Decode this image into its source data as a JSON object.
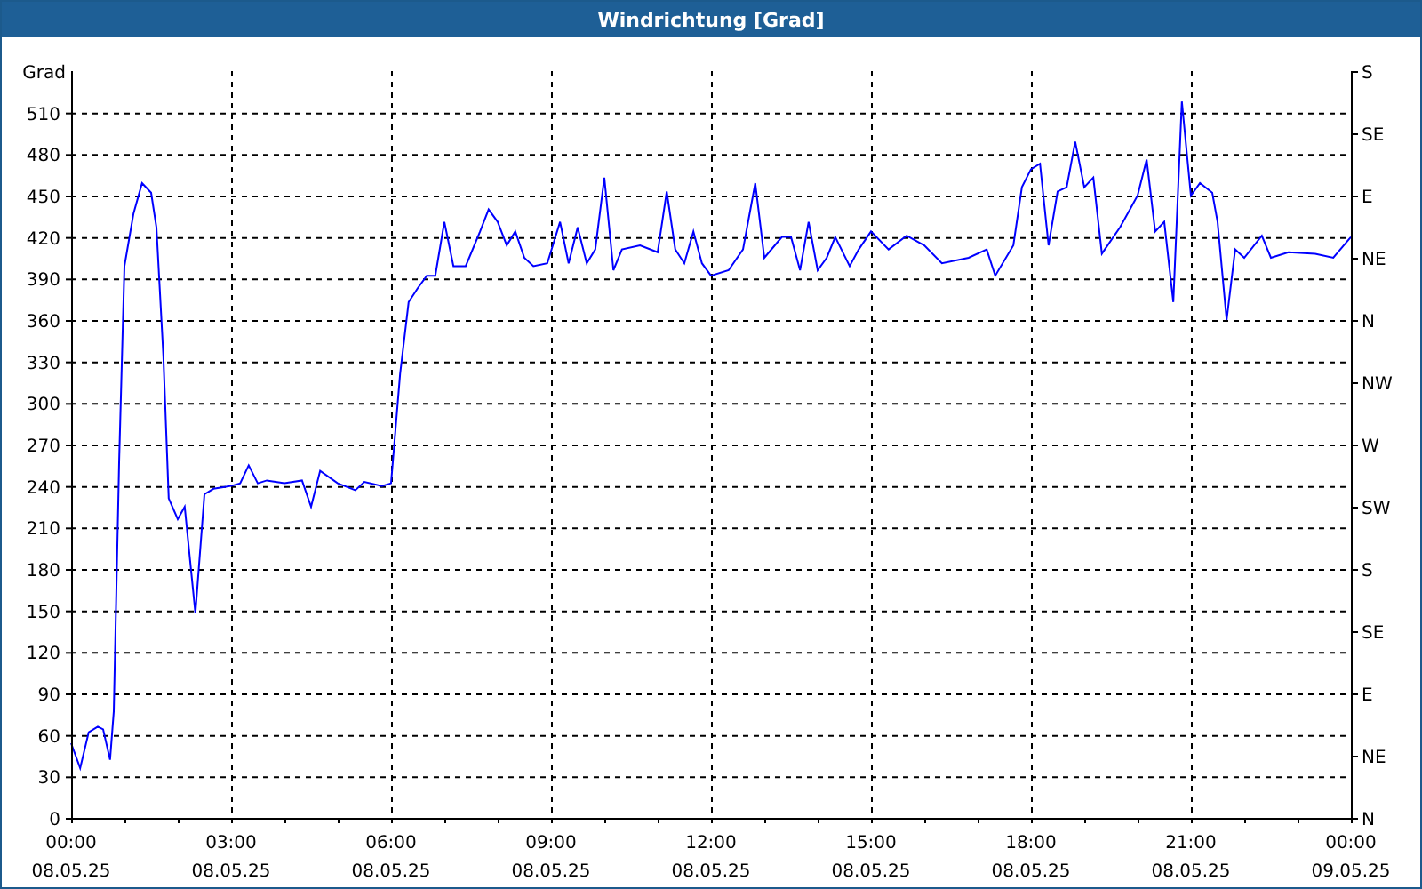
{
  "window": {
    "title": "Windrichtung [Grad]"
  },
  "chart": {
    "xtick_dates": [
      "08.05.25",
      "08.05.25",
      "08.05.25",
      "08.05.25",
      "08.05.25",
      "08.05.25",
      "08.05.25",
      "08.05.25",
      "09.05.25"
    ],
    "right_axis": [
      "S",
      "SE",
      "E",
      "NE",
      "N",
      "NW",
      "W",
      "SW",
      "S",
      "SE",
      "E",
      "NE",
      "N"
    ],
    "chart_data": {
      "type": "line",
      "grid": true,
      "ylabel": "Grad",
      "xlim": [
        0,
        24
      ],
      "ylim": [
        0,
        540
      ],
      "xticks": [
        {
          "value": 0,
          "label": "00:00"
        },
        {
          "value": 3,
          "label": "03:00"
        },
        {
          "value": 6,
          "label": "06:00"
        },
        {
          "value": 9,
          "label": "09:00"
        },
        {
          "value": 12,
          "label": "12:00"
        },
        {
          "value": 15,
          "label": "15:00"
        },
        {
          "value": 18,
          "label": "18:00"
        },
        {
          "value": 21,
          "label": "21:00"
        },
        {
          "value": 24,
          "label": "00:00"
        }
      ],
      "yticks": [
        0,
        30,
        60,
        90,
        120,
        150,
        180,
        210,
        240,
        270,
        300,
        330,
        360,
        390,
        420,
        450,
        480,
        510
      ],
      "x": [
        0,
        0.17,
        0.33,
        0.5,
        0.6,
        0.73,
        0.8,
        0.9,
        1,
        1.17,
        1.33,
        1.5,
        1.6,
        1.73,
        1.83,
        2,
        2.13,
        2.33,
        2.5,
        2.67,
        3,
        3.17,
        3.33,
        3.5,
        3.67,
        4,
        4.33,
        4.5,
        4.67,
        5,
        5.33,
        5.5,
        5.83,
        6,
        6.17,
        6.33,
        6.5,
        6.67,
        6.83,
        7,
        7.17,
        7.4,
        7.67,
        7.83,
        8,
        8.17,
        8.33,
        8.5,
        8.67,
        8.93,
        9.17,
        9.33,
        9.5,
        9.67,
        9.83,
        10,
        10.17,
        10.33,
        10.67,
        11,
        11.17,
        11.33,
        11.5,
        11.67,
        11.83,
        12,
        12.33,
        12.6,
        12.83,
        13,
        13.33,
        13.5,
        13.67,
        13.83,
        14,
        14.17,
        14.33,
        14.6,
        14.77,
        15,
        15.33,
        15.67,
        16,
        16.33,
        16.83,
        17.17,
        17.33,
        17.67,
        17.83,
        18,
        18.17,
        18.33,
        18.5,
        18.67,
        18.83,
        19,
        19.17,
        19.33,
        19.67,
        20,
        20.17,
        20.33,
        20.5,
        20.67,
        20.83,
        21,
        21.17,
        21.4,
        21.5,
        21.67,
        21.83,
        22,
        22.33,
        22.5,
        22.83,
        23.33,
        23.67,
        24
      ],
      "series": [
        {
          "color": "#0000ff",
          "values": [
            54,
            36,
            62,
            66,
            64,
            42,
            77,
            257,
            399,
            437,
            459,
            452,
            427,
            334,
            231,
            216,
            225,
            148,
            234,
            238,
            240,
            242,
            255,
            242,
            244,
            242,
            244,
            225,
            251,
            242,
            237,
            243,
            240,
            242,
            321,
            373,
            383,
            392,
            392,
            431,
            399,
            399,
            424,
            440,
            431,
            414,
            424,
            405,
            399,
            401,
            431,
            401,
            427,
            401,
            411,
            463,
            396,
            411,
            414,
            409,
            453,
            411,
            401,
            424,
            401,
            392,
            396,
            411,
            459,
            405,
            420,
            420,
            396,
            431,
            396,
            405,
            420,
            399,
            411,
            424,
            411,
            421,
            414,
            401,
            405,
            411,
            392,
            414,
            456,
            469,
            473,
            414,
            453,
            456,
            489,
            456,
            463,
            408,
            427,
            450,
            476,
            424,
            431,
            373,
            518,
            450,
            459,
            452,
            431,
            360,
            411,
            405,
            421,
            405,
            409,
            408,
            405,
            420
          ]
        }
      ]
    }
  }
}
